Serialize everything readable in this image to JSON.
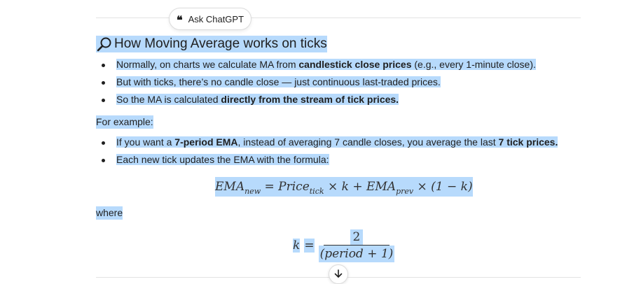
{
  "toolbar": {
    "ask_label": "Ask ChatGPT",
    "quote_icon": "quote-icon"
  },
  "section": {
    "icon": "magnifying-glass-icon",
    "title": "How Moving Average works on ticks",
    "bullets1": [
      {
        "pre": "Normally, on charts we calculate MA from ",
        "bold": "candlestick close prices",
        "post": " (e.g., every 1-minute close)."
      },
      {
        "pre": "But with ticks, there’s no candle close — just continuous last-traded prices.",
        "bold": "",
        "post": ""
      },
      {
        "pre": "So the MA is calculated ",
        "bold": "directly from the stream of tick prices.",
        "post": ""
      }
    ],
    "example_label": "For example:",
    "bullets2": [
      {
        "pre": "If you want a ",
        "bold1": "7-period EMA",
        "mid": ", instead of averaging 7 candle closes, you average the last ",
        "bold2": "7 tick prices."
      },
      {
        "text": "Each new tick updates the EMA with the formula:"
      }
    ],
    "formula1": {
      "ema": "EMA",
      "sub_new": "new",
      "eq": "=",
      "price": "Price",
      "sub_tick": "tick",
      "times": "×",
      "k": "k",
      "plus": "+",
      "ema2": "EMA",
      "sub_prev": "prev",
      "times2": "×",
      "paren": "(1 − k)"
    },
    "where_label": "where",
    "formula2": {
      "k": "k",
      "eq": "=",
      "num": "2",
      "den": "(period + 1)"
    }
  },
  "scroll_button": {
    "icon": "arrow-down-icon"
  }
}
